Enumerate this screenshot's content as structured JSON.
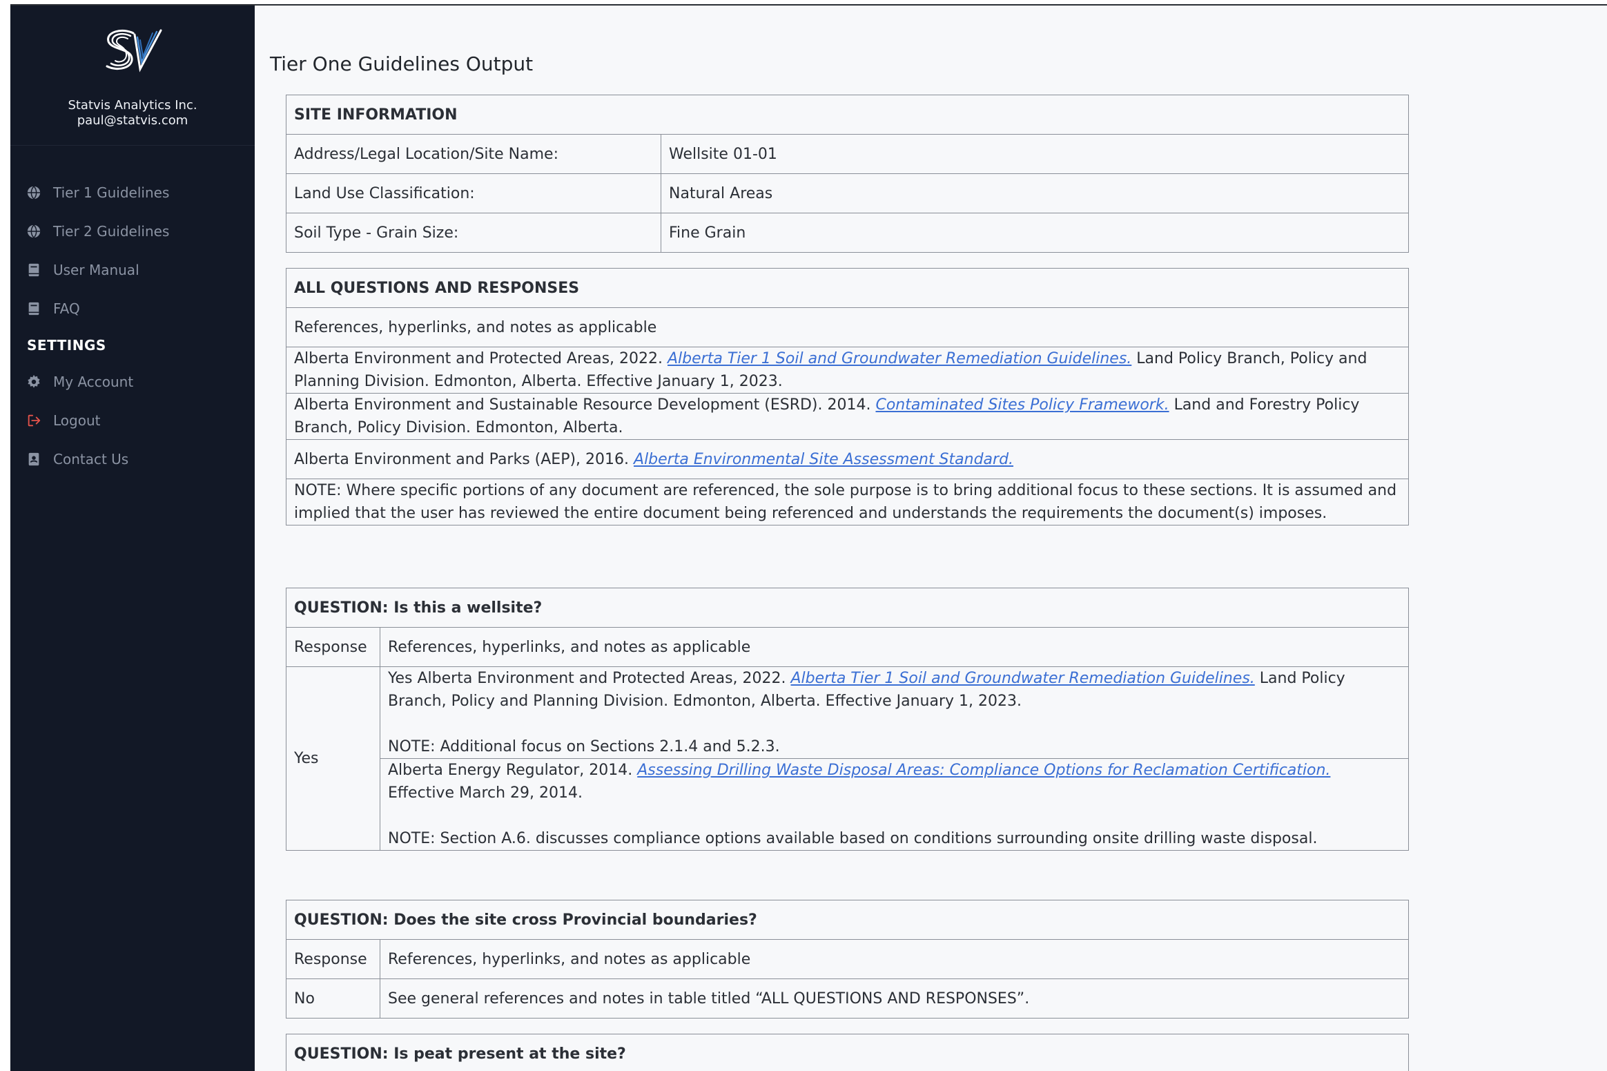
{
  "sidebar": {
    "company": "Statvis Analytics Inc.",
    "email": "paul@statvis.com",
    "nav": [
      {
        "label": "Tier 1 Guidelines",
        "icon": "globe-icon"
      },
      {
        "label": "Tier 2 Guidelines",
        "icon": "globe-icon"
      },
      {
        "label": "User Manual",
        "icon": "book-icon"
      },
      {
        "label": "FAQ",
        "icon": "book-icon"
      }
    ],
    "settings_label": "SETTINGS",
    "settings": [
      {
        "label": "My Account",
        "icon": "gear-icon"
      },
      {
        "label": "Logout",
        "icon": "logout-icon"
      },
      {
        "label": "Contact Us",
        "icon": "contact-icon"
      }
    ]
  },
  "colors": {
    "sidebar_bg": "#121826",
    "link": "#3b6fd4",
    "logout_icon": "#e5534b",
    "main_bg": "#f7f8fa"
  },
  "page": {
    "title": "Tier One Guidelines Output"
  },
  "site_info": {
    "header": "SITE INFORMATION",
    "rows": [
      {
        "label": "Address/Legal Location/Site Name:",
        "value": "Wellsite 01-01"
      },
      {
        "label": "Land Use Classification:",
        "value": "Natural Areas"
      },
      {
        "label": "Soil Type - Grain Size:",
        "value": "Fine Grain"
      }
    ]
  },
  "all_q": {
    "header": "ALL QUESTIONS AND RESPONSES",
    "subheader": "References, hyperlinks, and notes as applicable",
    "refs": [
      {
        "pre": "Alberta Environment and Protected Areas, 2022. ",
        "link": "Alberta Tier 1 Soil and Groundwater Remediation Guidelines.",
        "post": " Land Policy Branch, Policy and Planning Division. Edmonton, Alberta. Effective January 1, 2023."
      },
      {
        "pre": "Alberta Environment and Sustainable Resource Development (ESRD). 2014. ",
        "link": "Contaminated Sites Policy Framework.",
        "post": " Land and Forestry Policy Branch, Policy Division. Edmonton, Alberta."
      },
      {
        "pre": "Alberta Environment and Parks (AEP), 2016. ",
        "link": "Alberta Environmental Site Assessment Standard.",
        "post": ""
      }
    ],
    "note": "NOTE: Where specific portions of any document are referenced, the sole purpose is to bring additional focus to these sections. It is assumed and implied that the user has reviewed the entire document being referenced and understands the requirements the document(s) imposes."
  },
  "q1": {
    "header": "QUESTION: Is this a wellsite?",
    "response_label": "Response",
    "refs_label": "References, hyperlinks, and notes as applicable",
    "answer": "Yes",
    "refs": [
      {
        "pre": "Yes Alberta Environment and Protected Areas, 2022. ",
        "link": "Alberta Tier 1 Soil and Groundwater Remediation Guidelines.",
        "post": " Land Policy Branch, Policy and Planning Division. Edmonton, Alberta. Effective January 1, 2023.",
        "note": "NOTE: Additional focus on Sections 2.1.4 and 5.2.3."
      },
      {
        "pre": "Alberta Energy Regulator, 2014. ",
        "link": "Assessing Drilling Waste Disposal Areas: Compliance Options for Reclamation Certification.",
        "post": " Effective March 29, 2014.",
        "note": "NOTE: Section A.6. discusses compliance options available based on conditions surrounding onsite drilling waste disposal."
      }
    ]
  },
  "q2": {
    "header": "QUESTION: Does the site cross Provincial boundaries?",
    "response_label": "Response",
    "refs_label": "References, hyperlinks, and notes as applicable",
    "answer": "No",
    "note": "See general references and notes in table titled “ALL QUESTIONS AND RESPONSES”."
  },
  "q3": {
    "header": "QUESTION: Is peat present at the site?"
  }
}
